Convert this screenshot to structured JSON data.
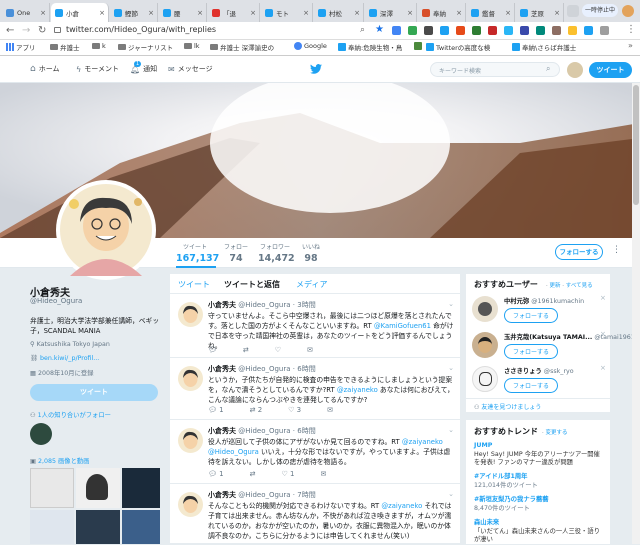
{
  "browser": {
    "tabs": [
      {
        "label": "One"
      },
      {
        "label": "小倉"
      },
      {
        "label": "鰹節"
      },
      {
        "label": "腰"
      },
      {
        "label": "「退"
      },
      {
        "label": "モト"
      },
      {
        "label": "村松"
      },
      {
        "label": "深澤"
      },
      {
        "label": "奉納"
      },
      {
        "label": "鑑督"
      },
      {
        "label": "芝原"
      }
    ],
    "user_label": "一時停止中",
    "url": "twitter.com/Hideo_Ogura/with_replies",
    "bookmarks": [
      "アプリ",
      "弁護士",
      "k",
      "ジャーナリスト",
      "lk",
      "弁護士 深澤諭史の",
      "Google",
      "奉納:危険生物・鳥",
      "",
      "Twitterの高度な検",
      "奉納\\さらば弁護士"
    ]
  },
  "nav": {
    "home": "ホーム",
    "moments": "モーメント",
    "notifications": "通知",
    "notif_count": "1",
    "messages": "メッセージ",
    "search_placeholder": "キーワード検索",
    "tweet_button": "ツイート"
  },
  "stats": [
    {
      "label": "ツイート",
      "value": "167,137"
    },
    {
      "label": "フォロー",
      "value": "74"
    },
    {
      "label": "フォロワー",
      "value": "14,472"
    },
    {
      "label": "いいね",
      "value": "98"
    }
  ],
  "follow_button": "フォローする",
  "profile": {
    "name": "小倉秀夫",
    "handle": "@Hideo_Ogura",
    "bio": "弁護士，明治大学法学部兼任講師，ベギッ子，SCANDAL MANIA",
    "location": "Katsushika Tokyo Japan",
    "link": "ben.kiwi/_p/Profil...",
    "joined": "2008年10月に登録",
    "tweet_button": "ツイート",
    "followers_you_know": "1人の知り合いがフォロー",
    "photos_label": "2,085 画像と動画"
  },
  "tabs": [
    {
      "label": "ツイート"
    },
    {
      "label": "ツイートと返信"
    },
    {
      "label": "メディア"
    }
  ],
  "tweets": [
    {
      "name": "小倉秀夫",
      "handle": "@Hideo_Ogura",
      "time": "3時間",
      "text": "守っていませんよ。そこら中空爆され，最後には二つほど原爆を落とされたんです。落とした国の方がよくそんなこといいますね。RT ",
      "mention": "@KamiGofuen61",
      "text2": " 命がけで日本を守った靖国神社の英霊は，あなたのツイートをどう評価するんでしょうね。",
      "replies": "",
      "retweets": "",
      "likes": ""
    },
    {
      "name": "小倉秀夫",
      "handle": "@Hideo_Ogura",
      "time": "6時間",
      "text": "というか，子供たちが自発的に検査の申告をできるようにしましょうという提案を，なんで潰そうとしているんですか?RT ",
      "mention": "@zaiyaneko",
      "text2": " あなたは何におびえて，こんな議論にならんつぶやきを連発してるんですか?",
      "replies": "1",
      "retweets": "2",
      "likes": "3"
    },
    {
      "name": "小倉秀夫",
      "handle": "@Hideo_Ogura",
      "time": "6時間",
      "text": "役人が巡回して子供の体にアザがないか見て回るのですね。RT ",
      "mention": "@zaiyaneko",
      "text2": " ",
      "mention2": "@Hideo_Ogura",
      "text3": " いいえ，十分な形ではないですが，やっていますよ。子供は虐待を訴えない。しかし体の痣が虐待を物語る。",
      "replies": "1",
      "retweets": "",
      "likes": "1"
    },
    {
      "name": "小倉秀夫",
      "handle": "@Hideo_Ogura",
      "time": "7時間",
      "text": "そんなことも公的機関が対応できるわけないですね。RT ",
      "mention": "@zaiyaneko",
      "text2": " それでは子育ては出来ません。赤ん坊なんか，不快があれば泣き喚きますが，オムツが濡れているのか，おなかが空いたのか，暑いのか，衣服に異物混入か，眠いのか体調不良なのか，こちらに分かるようには申告してくれません(笑い)",
      "replies": "",
      "retweets": "",
      "likes": ""
    }
  ],
  "recommended": {
    "title": "おすすめユーザー",
    "refresh": "更新",
    "all": "すべて見る",
    "follow": "フォローする",
    "users": [
      {
        "name": "中村元弥",
        "handle": "@1961kumachin"
      },
      {
        "name": "玉井克哉(Katsuya TAMAI...",
        "handle": "@tamai1961"
      },
      {
        "name": "ささきりょう",
        "handle": "@ssk_ryo"
      }
    ],
    "find": "友達を見つけましょう"
  },
  "trends": {
    "title": "おすすめトレンド",
    "change": "変更する",
    "items": [
      {
        "name": "JUMP",
        "desc": "Hey! Say! JUMP 今年のアリーナツアー開催を発表! ファンのマナー違反が問題"
      },
      {
        "name": "#アイドル部1周年",
        "desc": "121,014件のツイート"
      },
      {
        "name": "#新垣友梨乃の我ナラ蕎蕎",
        "desc": "8,470件のツイート"
      },
      {
        "name": "森山未来",
        "desc": "「いだてん」森山未来さんの一人三役・語りが凄い"
      }
    ]
  }
}
